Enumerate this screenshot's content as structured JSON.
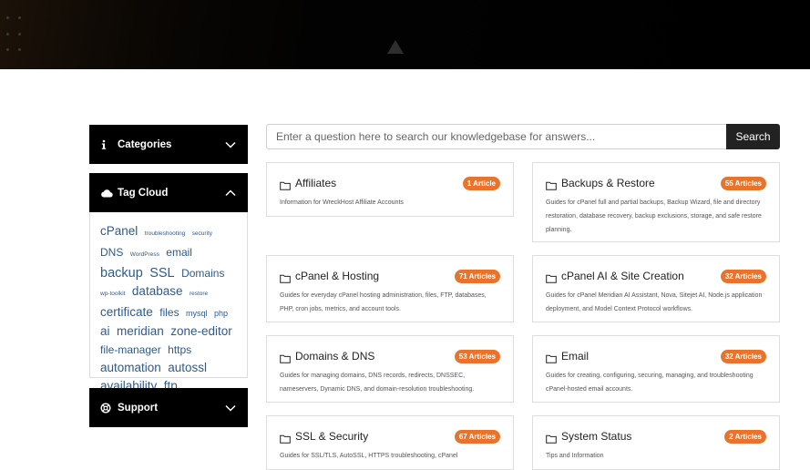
{
  "sidebar": {
    "categories": {
      "label": "Categories"
    },
    "tag_cloud": {
      "label": "Tag Cloud",
      "tags": [
        {
          "text": "cPanel",
          "size": "l"
        },
        {
          "text": "troubleshooting",
          "size": "xs"
        },
        {
          "text": "security",
          "size": "xs"
        },
        {
          "text": "DNS",
          "size": "m"
        },
        {
          "text": "WordPress",
          "size": "xs"
        },
        {
          "text": "email",
          "size": "m"
        },
        {
          "text": "backup",
          "size": "xl"
        },
        {
          "text": "SSL",
          "size": "xl"
        },
        {
          "text": "Domains",
          "size": "m"
        },
        {
          "text": "wp-toolkit",
          "size": "xs"
        },
        {
          "text": "database",
          "size": "l"
        },
        {
          "text": "restore",
          "size": "xs"
        },
        {
          "text": "certificate",
          "size": "l"
        },
        {
          "text": "files",
          "size": "m"
        },
        {
          "text": "mysql",
          "size": "s"
        },
        {
          "text": "php",
          "size": "s"
        },
        {
          "text": "ai",
          "size": "l"
        },
        {
          "text": "meridian",
          "size": "l"
        },
        {
          "text": "zone-editor",
          "size": "l"
        },
        {
          "text": "file-manager",
          "size": "m"
        },
        {
          "text": "https",
          "size": "m"
        },
        {
          "text": "automation",
          "size": "l"
        },
        {
          "text": "autossl",
          "size": "l"
        },
        {
          "text": "availability",
          "size": "l"
        },
        {
          "text": "ftp",
          "size": "l"
        }
      ]
    },
    "support": {
      "label": "Support"
    }
  },
  "search": {
    "placeholder": "Enter a question here to search our knowledgebase for answers...",
    "button": "Search"
  },
  "categories": [
    {
      "title": "Affiliates",
      "badge": "1 Article",
      "desc": "Information for WreckHost Affiliate Accounts"
    },
    {
      "title": "Backups & Restore",
      "badge": "55 Articles",
      "desc": "Guides for cPanel full and partial backups, Backup Wizard, file and directory restoration, database recovery, backup exclusions, storage, and safe restore planning."
    },
    {
      "title": "cPanel & Hosting",
      "badge": "71 Articles",
      "desc": "Guides for everyday cPanel hosting administration, files, FTP, databases, PHP, cron jobs, metrics, and account tools."
    },
    {
      "title": "cPanel AI & Site Creation",
      "badge": "32 Articles",
      "desc": "Guides for cPanel Meridian AI Assistant, Nova, Sitejet AI, Node.js application deployment, and Model Context Protocol workflows."
    },
    {
      "title": "Domains & DNS",
      "badge": "53 Articles",
      "desc": "Guides for managing domains, DNS records, redirects, DNSSEC, nameservers, Dynamic DNS, and domain-resolution troubleshooting."
    },
    {
      "title": "Email",
      "badge": "32 Articles",
      "desc": "Guides for creating, configuring, securing, managing, and troubleshooting cPanel-hosted email accounts."
    },
    {
      "title": "SSL & Security",
      "badge": "67 Articles",
      "desc": "Guides for SSL/TLS, AutoSSL, HTTPS troubleshooting, cPanel"
    },
    {
      "title": "System Status",
      "badge": "2 Articles",
      "desc": "Tips and Information"
    }
  ]
}
